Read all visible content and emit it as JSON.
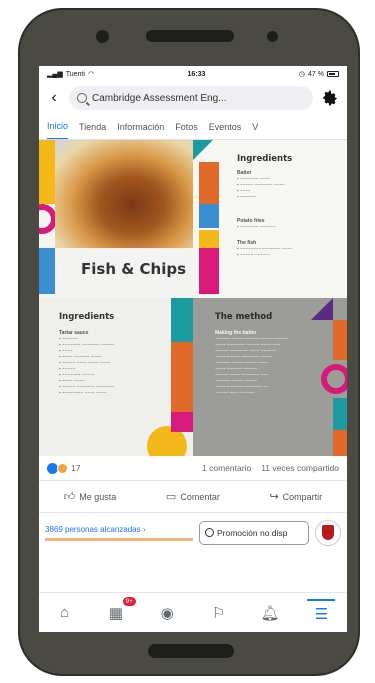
{
  "status": {
    "carrier": "Tuenti",
    "time": "16:33",
    "battery": "47 %"
  },
  "header": {
    "search_text": "Cambridge Assessment Eng..."
  },
  "tabs": [
    {
      "label": "Inicio"
    },
    {
      "label": "Tienda"
    },
    {
      "label": "Información"
    },
    {
      "label": "Fotos"
    },
    {
      "label": "Eventos"
    },
    {
      "label": "V"
    }
  ],
  "post": {
    "dish_title": "Fish & Chips",
    "ingredients_title_right": "Ingredients",
    "batter_label": "Batter",
    "potato_label": "Potato fries",
    "chips_label": "The fish",
    "ingredients_title_left": "Ingredients",
    "tartar_label": "Tartar sauce",
    "method_title": "The method",
    "method_sub": "Making the batter"
  },
  "reactions": {
    "count": "17",
    "comments": "1 comentario",
    "shares": "11 veces compartido"
  },
  "actions": {
    "like": "Me gusta",
    "comment": "Comentar",
    "share": "Compartir"
  },
  "promo": {
    "people_reached": "3869 personas alcanzadas",
    "arrow": "›",
    "button": "Promoción no disp"
  },
  "nav": {
    "notifications_badge": "9+"
  },
  "colors": {
    "accent": "#1877f2",
    "pink": "#d81b7a",
    "yellow": "#f5b81a",
    "teal": "#1b9aa0",
    "orange": "#e06a2a",
    "purple": "#5b2b82"
  }
}
